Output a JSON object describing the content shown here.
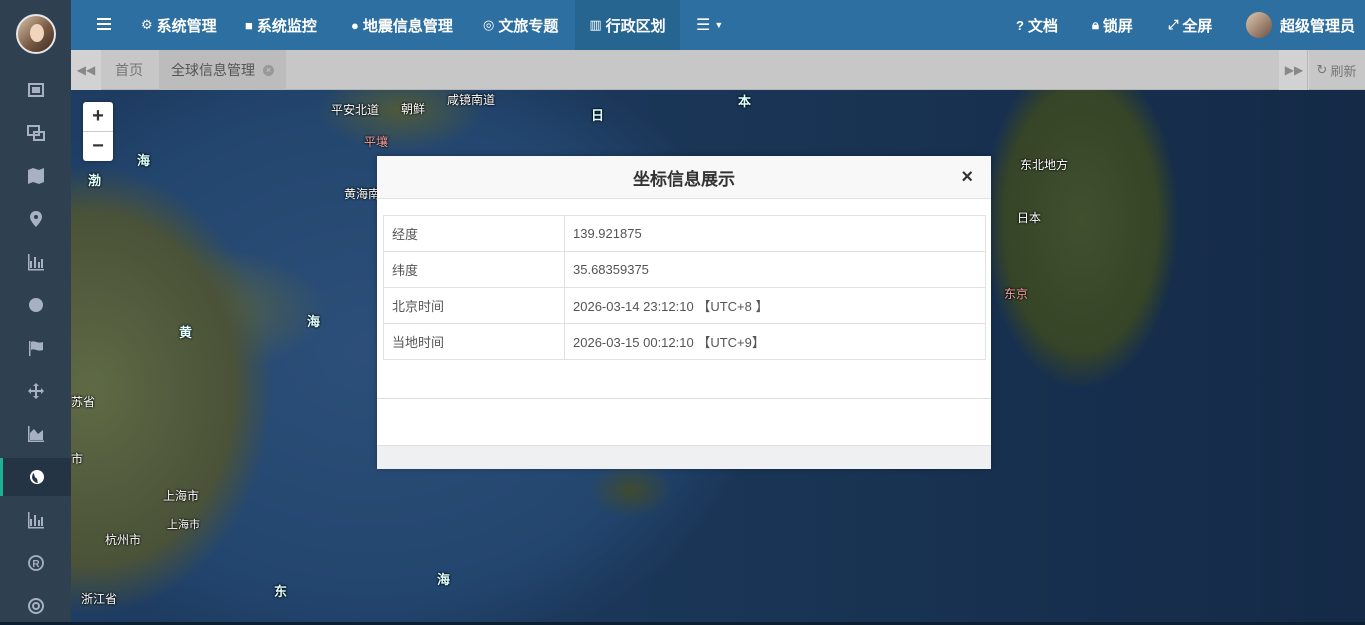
{
  "topnav": {
    "items": [
      {
        "label": "系统管理",
        "icon": "gear-icon"
      },
      {
        "label": "系统监控",
        "icon": "video-icon"
      },
      {
        "label": "地震信息管理",
        "icon": "pin-icon"
      },
      {
        "label": "文旅专题",
        "icon": "lifebuoy-icon"
      },
      {
        "label": "行政区划",
        "icon": "bank-icon"
      }
    ],
    "right": {
      "docs": "文档",
      "lock": "锁屏",
      "fullscreen": "全屏",
      "user": "超级管理员"
    }
  },
  "tabs": {
    "home": "首页",
    "active": "全球信息管理",
    "refresh": "刷新"
  },
  "map": {
    "zoom_in": "+",
    "zoom_out": "−",
    "labels": {
      "l1": "平安北道",
      "l2": "朝鲜",
      "l3": "咸镜南道",
      "l4": "日",
      "l5": "本",
      "l6": "平壤",
      "l7": "海",
      "l8": "渤",
      "l9": "黄海南",
      "l10": "东北地方",
      "l11": "日本",
      "l12": "东京",
      "l13": "黄",
      "l14": "海",
      "l15": "苏省",
      "l16": "市",
      "l17": "上海市",
      "l18": "上海市",
      "l19": "杭州市",
      "l20": "浙江省",
      "l21": "东",
      "l22": "海"
    }
  },
  "modal": {
    "title": "坐标信息展示",
    "close": "×",
    "rows": [
      {
        "key": "经度",
        "value": "139.921875"
      },
      {
        "key": "纬度",
        "value": "35.68359375"
      },
      {
        "key": "北京时间",
        "value": "2026-03-14 23:12:10 【UTC+8 】"
      },
      {
        "key": "当地时间",
        "value": "2026-03-15 00:12:10 【UTC+9】"
      }
    ]
  },
  "colors": {
    "topbar": "#2d6fa0",
    "sidebar": "#2f4050",
    "accent": "#1ab394"
  }
}
